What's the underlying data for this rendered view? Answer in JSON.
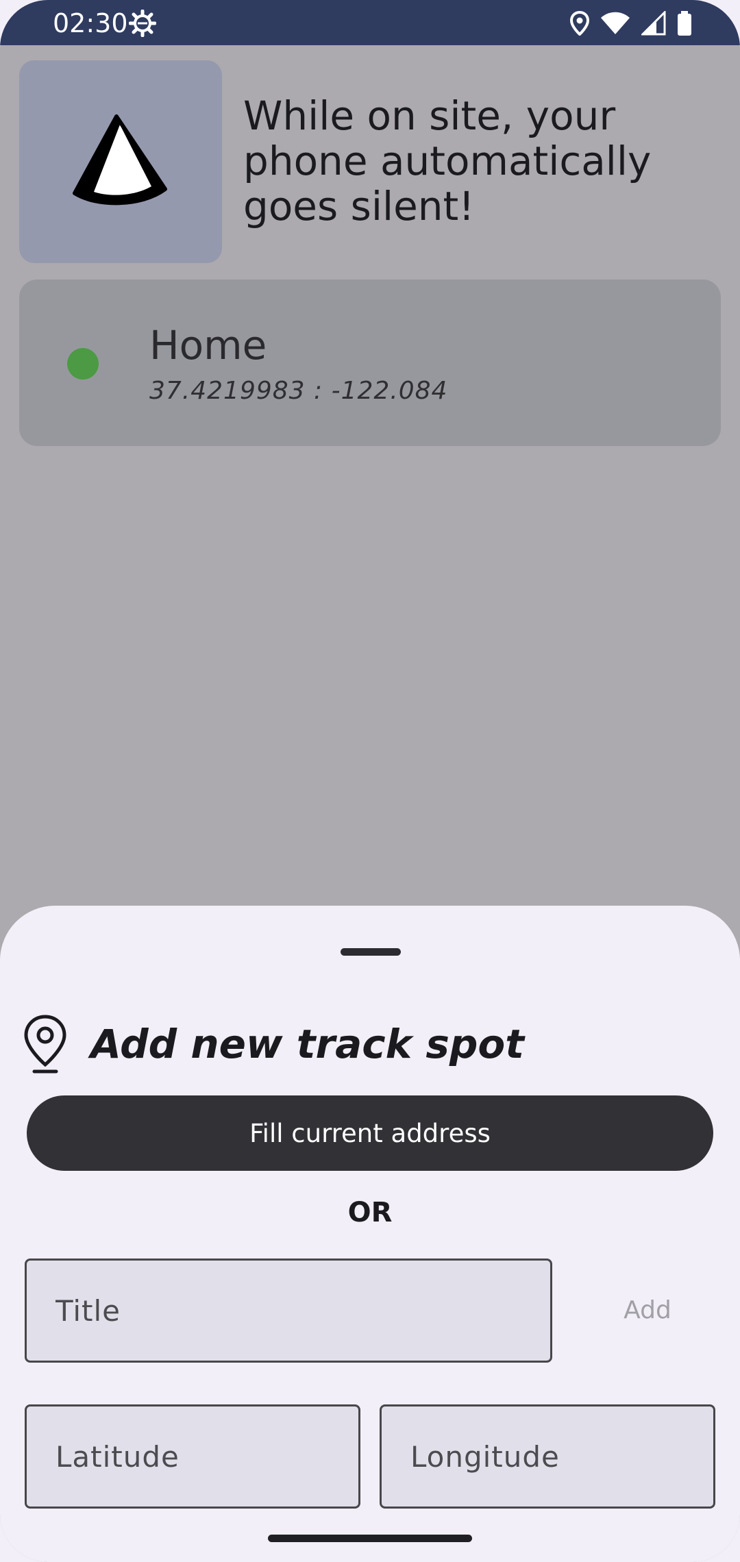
{
  "status_bar": {
    "time": "02:30",
    "icons": [
      "settings-gear-icon",
      "location-icon",
      "wifi-icon",
      "signal-icon",
      "battery-icon"
    ]
  },
  "header": {
    "icon": "silent-cone-icon",
    "message": "While on site, your phone automatically goes silent!"
  },
  "spots": [
    {
      "name": "Home",
      "coords": "37.4219983 : -122.084",
      "status_color": "#4c9a44"
    }
  ],
  "sheet": {
    "icon": "map-pin-icon",
    "title": "Add new track spot",
    "fill_button_label": "Fill current address",
    "or_label": "OR",
    "title_placeholder": "Title",
    "add_button_label": "Add",
    "latitude_placeholder": "Latitude",
    "longitude_placeholder": "Longitude"
  },
  "colors": {
    "status_bar": "#2f3b5f",
    "scrim": "#acaaae",
    "sheet_bg": "#f3eff8",
    "primary_button": "#313136"
  }
}
